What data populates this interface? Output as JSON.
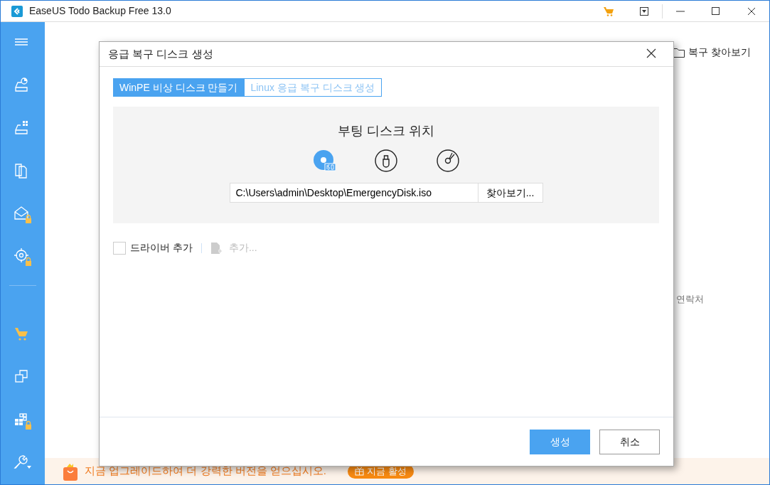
{
  "window": {
    "title": "EaseUS Todo Backup Free 13.0"
  },
  "sidebar": {
    "items": [
      {
        "kind": "menu",
        "locked": false
      },
      {
        "kind": "disk-backup",
        "locked": false
      },
      {
        "kind": "system-backup",
        "locked": false
      },
      {
        "kind": "file-backup",
        "locked": false
      },
      {
        "kind": "mail-backup",
        "locked": true
      },
      {
        "kind": "smart-backup",
        "locked": true
      },
      {
        "kind": "divider"
      },
      {
        "kind": "cart",
        "locked": false
      },
      {
        "kind": "clone",
        "locked": false
      },
      {
        "kind": "windows",
        "locked": true
      },
      {
        "kind": "tools",
        "locked": false
      }
    ]
  },
  "background": {
    "browse_recovery": "복구 찾아보기",
    "contact": "연락처"
  },
  "dialog": {
    "title": "응급 복구 디스크 생성",
    "tabs": [
      {
        "label": "WinPE 비상 디스크 만들기",
        "selected": true
      },
      {
        "label": "Linux 응급 복구 디스크 생성",
        "selected": false
      }
    ],
    "section_title": "부팅 디스크 위치",
    "boot_options": [
      {
        "kind": "iso",
        "selected": true
      },
      {
        "kind": "usb",
        "selected": false
      },
      {
        "kind": "cd",
        "selected": false
      }
    ],
    "path_field": {
      "value": "C:\\Users\\admin\\Desktop\\EmergencyDisk.iso"
    },
    "browse_button": "찾아보기...",
    "driver_option": {
      "label": "드라이버 추가",
      "checked": false
    },
    "add_button": {
      "label": "추가...",
      "disabled": true
    },
    "buttons": [
      {
        "label": "생성",
        "kind": "primary"
      },
      {
        "label": "취소",
        "kind": "secondary"
      }
    ]
  },
  "banner": {
    "message": "지금 업그레이드하여 더 강력한 버전을 얻으십시오.",
    "button": "지금 활성"
  }
}
